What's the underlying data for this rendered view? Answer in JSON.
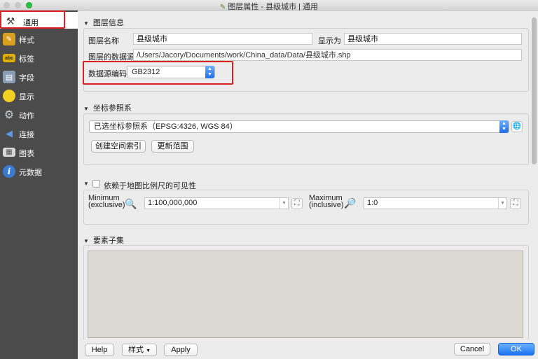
{
  "window": {
    "title": "图层属性 - 县级城市 | 通用"
  },
  "sidebar": {
    "items": [
      {
        "label": "通用",
        "icon": "hammer-wrench-icon",
        "color": "#c9c9c9"
      },
      {
        "label": "样式",
        "icon": "paintbrush-icon",
        "color": "#d9a020"
      },
      {
        "label": "标签",
        "icon": "abc-label-icon",
        "color": "#e0b000"
      },
      {
        "label": "字段",
        "icon": "table-icon",
        "color": "#8a9fb5"
      },
      {
        "label": "显示",
        "icon": "speech-bubble-icon",
        "color": "#f0d020"
      },
      {
        "label": "动作",
        "icon": "gear-icon",
        "color": "#9aa3ad"
      },
      {
        "label": "连接",
        "icon": "join-arrow-icon",
        "color": "#3a7ad0"
      },
      {
        "label": "图表",
        "icon": "diagram-icon",
        "color": "#8a8a8a"
      },
      {
        "label": "元数据",
        "icon": "info-icon",
        "color": "#3a7ad0"
      }
    ]
  },
  "layer_info": {
    "title": "图层信息",
    "name_label": "图层名称",
    "name_value": "县级城市",
    "display_label": "显示为",
    "display_value": "县级城市",
    "source_label": "图层的数据源",
    "source_value": "/Users/Jacory/Documents/work/China_data/Data/县级城市.shp",
    "encoding_label": "数据源编码",
    "encoding_value": "GB2312"
  },
  "crs": {
    "title": "坐标参照系",
    "selected": "已选坐标参照系（EPSG:4326, WGS 84）",
    "create_index_btn": "创建空间索引",
    "update_extent_btn": "更新范围"
  },
  "scale_visibility": {
    "title": "依赖于地图比例尺的可见性",
    "min_label_1": "Minimum",
    "min_label_2": "(exclusive)",
    "min_value": "1:100,000,000",
    "max_label_1": "Maximum",
    "max_label_2": "(inclusive)",
    "max_value": "1:0"
  },
  "subset": {
    "title": "要素子集"
  },
  "buttons": {
    "help": "Help",
    "style": "样式",
    "apply": "Apply",
    "cancel": "Cancel",
    "ok": "OK"
  },
  "colors": {
    "sidebar_bg": "#4b4b4b",
    "highlight_red": "#e02020",
    "accent_blue": "#1c72f0"
  }
}
